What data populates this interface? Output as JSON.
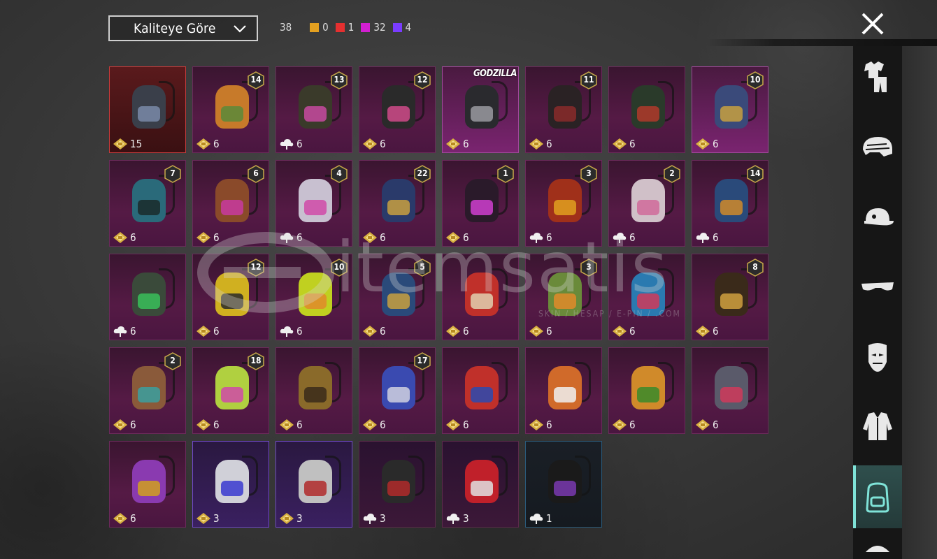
{
  "sort": {
    "label": "Kaliteye Göre"
  },
  "counts": {
    "total": "38",
    "items": [
      {
        "color": "#e3a020",
        "value": "0"
      },
      {
        "color": "#e53030",
        "value": "1"
      },
      {
        "color": "#d21fd0",
        "value": "32"
      },
      {
        "color": "#7a3cff",
        "value": "4"
      }
    ]
  },
  "sidebar": {
    "categories": [
      {
        "name": "outfit",
        "active": false
      },
      {
        "name": "helmet",
        "active": false
      },
      {
        "name": "hat",
        "active": false
      },
      {
        "name": "glasses",
        "active": false
      },
      {
        "name": "mask",
        "active": false
      },
      {
        "name": "jacket",
        "active": false
      },
      {
        "name": "backpack",
        "active": true
      }
    ]
  },
  "watermark": {
    "text": "itemsatis",
    "sub": "SKIN / HESAP / E-PIN / .COM"
  },
  "items": [
    {
      "rarity": "legend",
      "level": "",
      "currency": "diamond",
      "count": "15",
      "color": "#3a3f4a",
      "accent": "#7a8aa8"
    },
    {
      "rarity": "mythic",
      "level": "14",
      "currency": "diamond",
      "count": "6",
      "color": "#c77a2a",
      "accent": "#5a8a3a"
    },
    {
      "rarity": "mythic",
      "level": "13",
      "currency": "cloud",
      "count": "6",
      "color": "#3a3a2a",
      "accent": "#c84aa0"
    },
    {
      "rarity": "mythic",
      "level": "12",
      "currency": "diamond",
      "count": "6",
      "color": "#2a2a2a",
      "accent": "#d04a8a"
    },
    {
      "rarity": "mythic bright",
      "level": "",
      "brand": "GODZILLA",
      "currency": "diamond",
      "count": "6",
      "color": "#2a2a2e",
      "accent": "#9a9aa0"
    },
    {
      "rarity": "mythic",
      "level": "11",
      "currency": "diamond",
      "count": "6",
      "color": "#2a2224",
      "accent": "#8a2a2a"
    },
    {
      "rarity": "mythic",
      "level": "",
      "currency": "diamond",
      "count": "6",
      "color": "#2a3a2a",
      "accent": "#b03a2a"
    },
    {
      "rarity": "mythic bright",
      "level": "10",
      "currency": "diamond",
      "count": "6",
      "color": "#3a4a7a",
      "accent": "#c8a040"
    },
    {
      "rarity": "mythic",
      "level": "7",
      "currency": "diamond",
      "count": "6",
      "color": "#2a6a7a",
      "accent": "#1a2a2a"
    },
    {
      "rarity": "mythic",
      "level": "6",
      "currency": "diamond",
      "count": "6",
      "color": "#8a4a2a",
      "accent": "#c83aa0"
    },
    {
      "rarity": "mythic",
      "level": "4",
      "currency": "cloud",
      "count": "6",
      "color": "#c8c0d0",
      "accent": "#d04aa8"
    },
    {
      "rarity": "mythic",
      "level": "22",
      "currency": "diamond",
      "count": "6",
      "color": "#2a3a6a",
      "accent": "#c8a040"
    },
    {
      "rarity": "mythic",
      "level": "1",
      "currency": "diamond",
      "count": "6",
      "color": "#2a1a2a",
      "accent": "#d040d0"
    },
    {
      "rarity": "mythic",
      "level": "3",
      "currency": "cloud",
      "count": "6",
      "color": "#a0301a",
      "accent": "#e0a020"
    },
    {
      "rarity": "mythic",
      "level": "2",
      "currency": "cloud",
      "count": "6",
      "color": "#d0c0c8",
      "accent": "#d06a9a"
    },
    {
      "rarity": "mythic",
      "level": "14",
      "currency": "cloud",
      "count": "6",
      "color": "#2a4a7a",
      "accent": "#d08a2a"
    },
    {
      "rarity": "mythic",
      "level": "",
      "currency": "cloud",
      "count": "6",
      "color": "#3a4a3a",
      "accent": "#3ac05a"
    },
    {
      "rarity": "mythic",
      "level": "12",
      "currency": "diamond",
      "count": "6",
      "color": "#d0b020",
      "accent": "#2a2a2a"
    },
    {
      "rarity": "mythic",
      "level": "10",
      "currency": "cloud",
      "count": "6",
      "color": "#c0d020",
      "accent": "#e08a2a"
    },
    {
      "rarity": "mythic",
      "level": "5",
      "currency": "diamond",
      "count": "6",
      "color": "#2a4a7a",
      "accent": "#c8a040"
    },
    {
      "rarity": "mythic",
      "level": "",
      "currency": "diamond",
      "count": "6",
      "color": "#c0302a",
      "accent": "#e0d0b0"
    },
    {
      "rarity": "mythic",
      "level": "3",
      "currency": "diamond",
      "count": "6",
      "color": "#6a8a3a",
      "accent": "#e08a2a"
    },
    {
      "rarity": "mythic",
      "level": "",
      "currency": "diamond",
      "count": "6",
      "color": "#2a7ab0",
      "accent": "#d03a5a"
    },
    {
      "rarity": "mythic",
      "level": "8",
      "currency": "diamond",
      "count": "6",
      "color": "#3a2a1a",
      "accent": "#d0a040"
    },
    {
      "rarity": "mythic",
      "level": "2",
      "currency": "diamond",
      "count": "6",
      "color": "#8a5a3a",
      "accent": "#3aa0a0"
    },
    {
      "rarity": "mythic",
      "level": "18",
      "currency": "diamond",
      "count": "6",
      "color": "#b0d040",
      "accent": "#d04aa8"
    },
    {
      "rarity": "mythic",
      "level": "",
      "currency": "diamond",
      "count": "6",
      "color": "#8a6a2a",
      "accent": "#3a2a1a"
    },
    {
      "rarity": "mythic",
      "level": "17",
      "currency": "diamond",
      "count": "6",
      "color": "#3a4ab0",
      "accent": "#d0d0e0"
    },
    {
      "rarity": "mythic",
      "level": "",
      "currency": "diamond",
      "count": "6",
      "color": "#c0302a",
      "accent": "#2a4ab0"
    },
    {
      "rarity": "mythic",
      "level": "",
      "currency": "diamond",
      "count": "6",
      "color": "#d06a2a",
      "accent": "#f0f0f0"
    },
    {
      "rarity": "mythic",
      "level": "",
      "currency": "diamond",
      "count": "6",
      "color": "#d08a2a",
      "accent": "#3a8a2a"
    },
    {
      "rarity": "mythic",
      "level": "",
      "currency": "diamond",
      "count": "6",
      "color": "#5a5a6a",
      "accent": "#d03a5a"
    },
    {
      "rarity": "mythic",
      "level": "",
      "currency": "diamond",
      "count": "6",
      "color": "#8a3ab0",
      "accent": "#d0a020"
    },
    {
      "rarity": "epic",
      "level": "",
      "currency": "diamond",
      "count": "3",
      "color": "#d0d0d8",
      "accent": "#3a3ad0"
    },
    {
      "rarity": "epic",
      "level": "",
      "currency": "diamond",
      "count": "3",
      "color": "#c0c0c0",
      "accent": "#b02a2a"
    },
    {
      "rarity": "rare",
      "level": "",
      "currency": "cloud",
      "count": "3",
      "color": "#2a2a2a",
      "accent": "#b02a2a"
    },
    {
      "rarity": "rare",
      "level": "",
      "currency": "cloud",
      "count": "3",
      "color": "#c0202a",
      "accent": "#e0e0e0"
    },
    {
      "rarity": "plain",
      "level": "",
      "currency": "cloud",
      "count": "1",
      "color": "#1a1a1a",
      "accent": "#7a3ab0"
    }
  ]
}
